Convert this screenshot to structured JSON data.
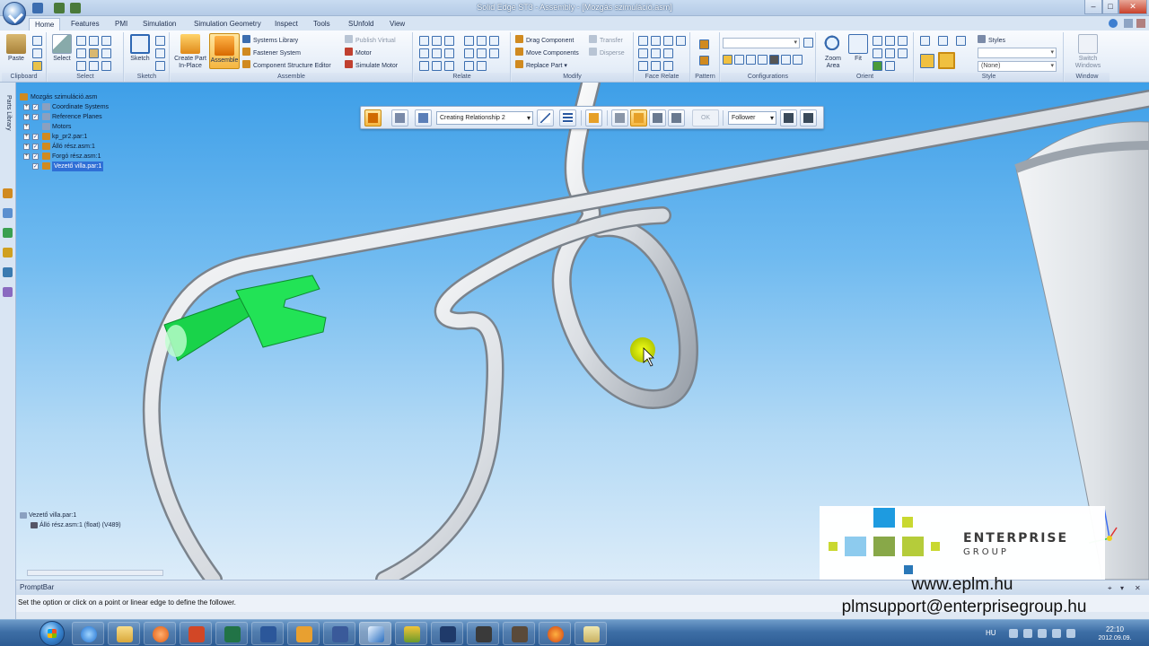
{
  "window": {
    "title": "Solid Edge ST3 - Assembly - [Mozgás szimuláció.asm]",
    "btn_min": "–",
    "btn_max": "□",
    "btn_close": "✕"
  },
  "ribbon": {
    "tabs": [
      "Home",
      "Features",
      "PMI",
      "Simulation",
      "Simulation Geometry",
      "Inspect",
      "Tools",
      "SUnfold",
      "View"
    ],
    "active_tab": "Home",
    "groups": {
      "clipboard": "Clipboard",
      "select": "Select",
      "sketch": "Sketch",
      "assemble": "Assemble",
      "relate": "Relate",
      "modify": "Modify",
      "face_relate": "Face Relate",
      "pattern": "Pattern",
      "configurations": "Configurations",
      "orient": "Orient",
      "style": "Style",
      "window": "Window"
    },
    "buttons": {
      "paste": "Paste",
      "select": "Select",
      "sketch": "Sketch",
      "create_part_1": "Create Part",
      "create_part_2": "In-Place",
      "assemble": "Assemble",
      "systems_library": "Systems Library",
      "fastener_system": "Fastener System",
      "component_structure_editor": "Component Structure Editor",
      "publish_virtual": "Publish Virtual",
      "motor": "Motor",
      "simulate_motor": "Simulate Motor",
      "drag_component": "Drag Component",
      "move_components": "Move Components",
      "replace_part": "Replace Part",
      "transfer": "Transfer",
      "disperse": "Disperse",
      "zoom_area_1": "Zoom",
      "zoom_area_2": "Area",
      "fit": "Fit",
      "styles": "Styles",
      "style_value": "(None)",
      "switch_windows_1": "Switch",
      "switch_windows_2": "Windows"
    }
  },
  "sidebar": {
    "parts_library": "Parts Library"
  },
  "tree": {
    "root": "Mozgás szimuláció.asm",
    "items": [
      {
        "label": "Coordinate Systems",
        "expandable": true,
        "checked": true
      },
      {
        "label": "Reference Planes",
        "expandable": true,
        "checked": true
      },
      {
        "label": "Motors",
        "expandable": true,
        "checked": false
      },
      {
        "label": "kp_pr2.par:1",
        "expandable": true,
        "checked": true
      },
      {
        "label": "Álló rész.asm:1",
        "expandable": true,
        "checked": true
      },
      {
        "label": "Forgó rész.asm:1",
        "expandable": true,
        "checked": true
      },
      {
        "label": "Vezető villa.par:1",
        "expandable": false,
        "checked": true,
        "selected": true
      }
    ]
  },
  "command_bar": {
    "step": "Creating Relationship 2",
    "ok": "OK",
    "mode": "Follower"
  },
  "bottom_tree": {
    "items": [
      "Vezető villa.par:1",
      "Álló rész.asm:1  (float)   (V489)"
    ]
  },
  "prompt": {
    "title": "PromptBar",
    "message": "Set the option or click on a point or linear edge to define the follower."
  },
  "branding": {
    "name": "ENTERPRISE",
    "group": "GROUP",
    "website": "www.eplm.hu",
    "email": "plmsupport@enterprisegroup.hu"
  },
  "taskbar": {
    "lang": "HU",
    "time": "22:10",
    "date": "2012.09.09."
  },
  "colors": {
    "accent": "#2f6fd6",
    "green_part": "#19d34a",
    "logo_blue": "#1e9be0",
    "logo_green": "#a8c83c"
  }
}
